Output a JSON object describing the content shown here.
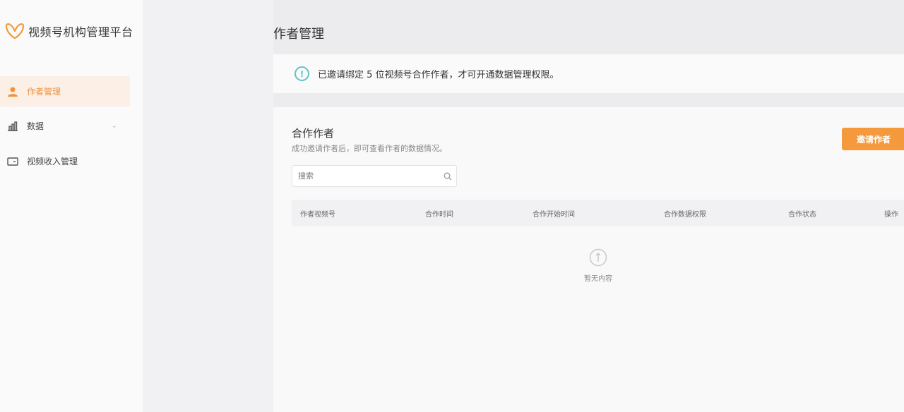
{
  "app": {
    "name": "视频号机构管理平台"
  },
  "sidebar": {
    "items": [
      {
        "label": "作者管理",
        "icon": "user-icon",
        "active": true
      },
      {
        "label": "数据",
        "icon": "bar-chart-icon",
        "active": false
      },
      {
        "label": "视频收入管理",
        "icon": "card-icon",
        "active": false
      }
    ]
  },
  "page": {
    "title": "作者管理"
  },
  "notice": {
    "icon": "info-icon",
    "text": "已邀请绑定 5 位视频号合作作者，才可开通数据管理权限。"
  },
  "card": {
    "title": "合作作者",
    "subtitle": "成功邀请作者后，即可查看作者的数据情况。",
    "invite_button": "邀请作者",
    "search": {
      "placeholder": "搜索"
    },
    "columns": [
      "作者视频号",
      "合作时间",
      "合作开始时间",
      "合作数据权限",
      "合作状态",
      "操作"
    ],
    "empty_text": "暂无内容"
  },
  "colors": {
    "accent": "#f59a3c",
    "info": "#5ec3c4",
    "active_bg": "#fcefe6"
  }
}
